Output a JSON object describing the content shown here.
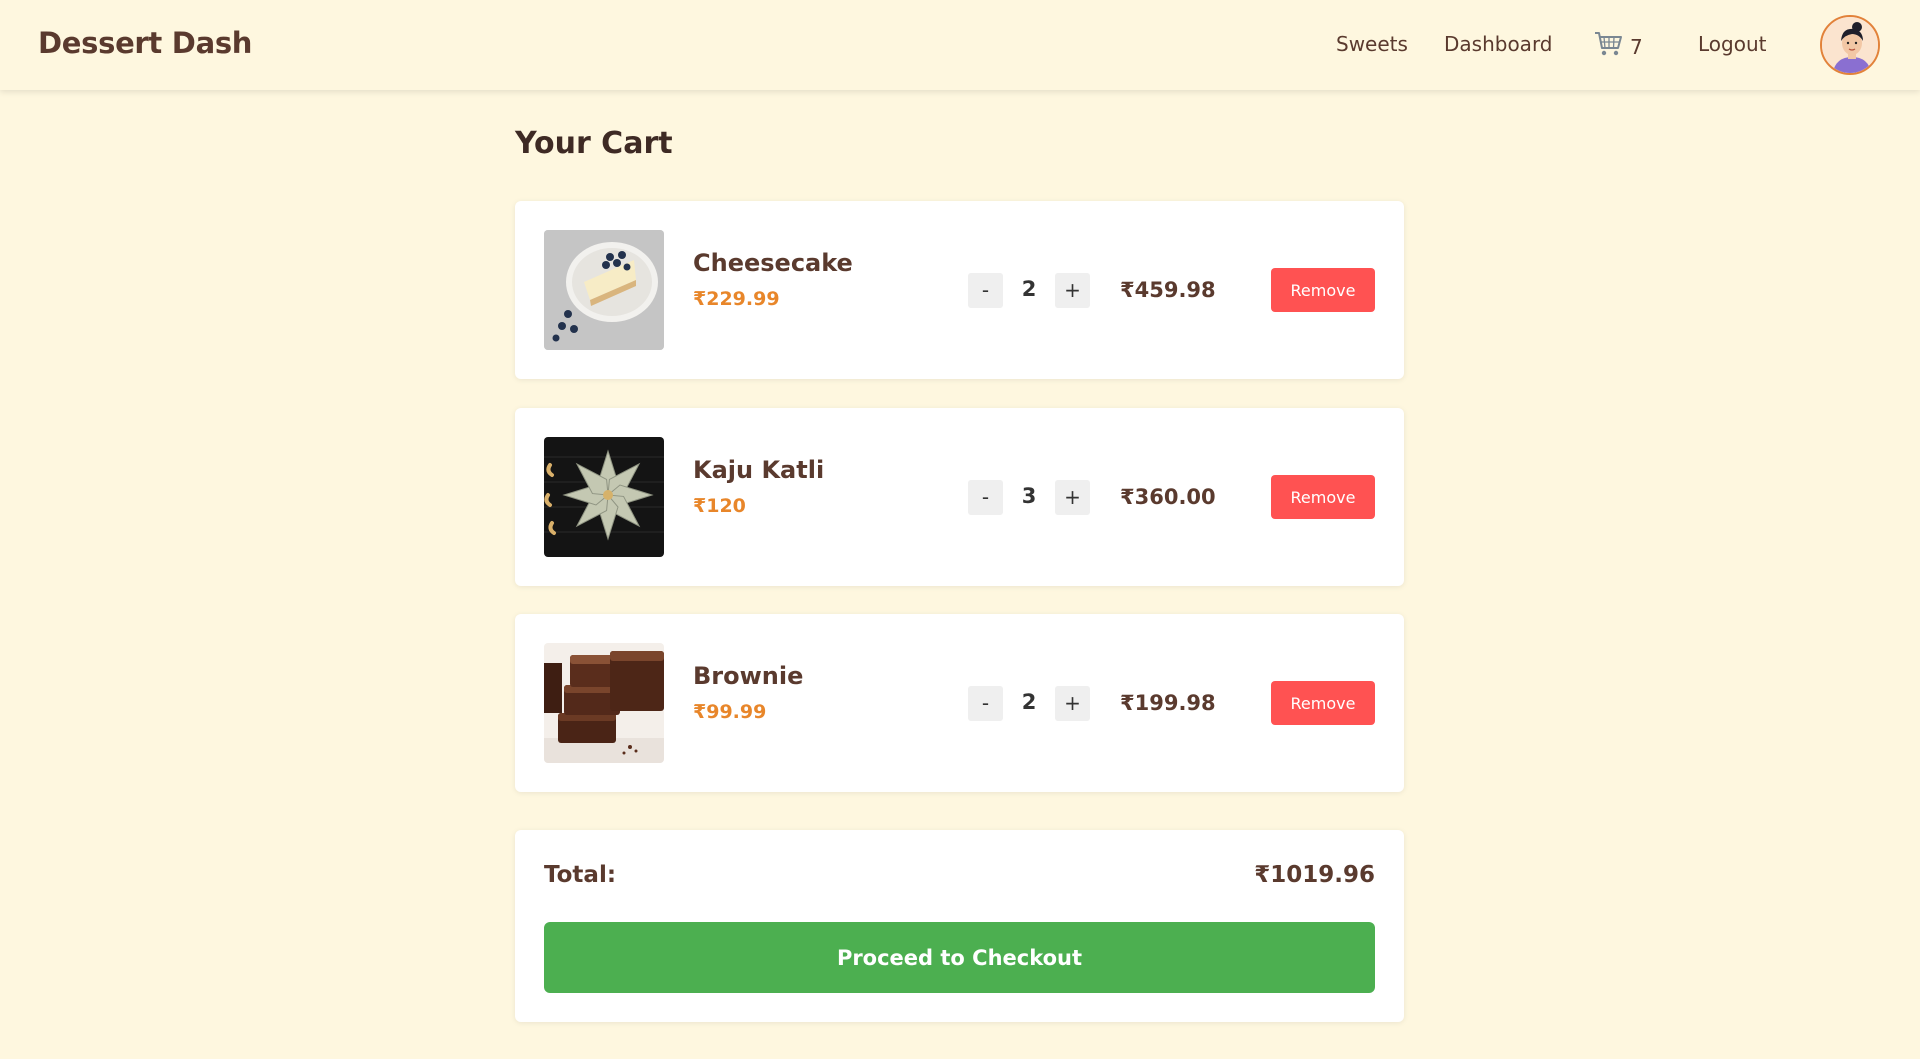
{
  "nav": {
    "brand": "Dessert Dash",
    "links": {
      "sweets": "Sweets",
      "dashboard": "Dashboard",
      "cart_count": "7",
      "logout": "Logout"
    },
    "cart_icon": "cart-icon",
    "avatar_icon": "user-avatar"
  },
  "cart": {
    "title": "Your Cart",
    "items": [
      {
        "name": "Cheesecake",
        "unit_price": "₹229.99",
        "quantity": "2",
        "line_total": "₹459.98",
        "remove_label": "Remove",
        "minus_label": "-",
        "plus_label": "+"
      },
      {
        "name": "Kaju Katli",
        "unit_price": "₹120",
        "quantity": "3",
        "line_total": "₹360.00",
        "remove_label": "Remove",
        "minus_label": "-",
        "plus_label": "+"
      },
      {
        "name": "Brownie",
        "unit_price": "₹99.99",
        "quantity": "2",
        "line_total": "₹199.98",
        "remove_label": "Remove",
        "minus_label": "-",
        "plus_label": "+"
      }
    ]
  },
  "summary": {
    "total_label": "Total:",
    "total_value": "₹1019.96",
    "checkout_label": "Proceed to Checkout"
  },
  "colors": {
    "background": "#fef7df",
    "brand_text": "#5a3a2e",
    "price_accent": "#e8862a",
    "remove_button": "#ff5252",
    "checkout_button": "#4caf50"
  }
}
